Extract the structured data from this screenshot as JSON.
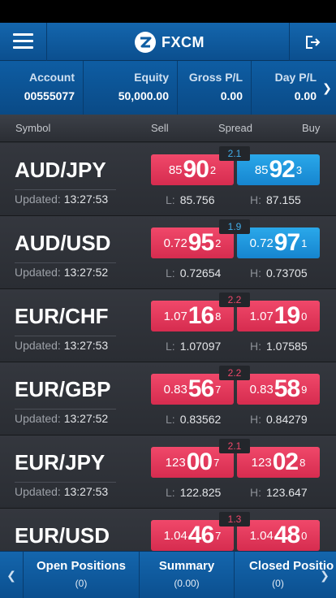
{
  "app": {
    "brand": "FXCM"
  },
  "account_bar": {
    "columns": [
      {
        "label": "Account",
        "value": "00555077"
      },
      {
        "label": "Equity",
        "value": "50,000.00"
      },
      {
        "label": "Gross P/L",
        "value": "0.00"
      },
      {
        "label": "Day P/L",
        "value": "0.00"
      }
    ]
  },
  "table_header": {
    "symbol": "Symbol",
    "sell": "Sell",
    "spread": "Spread",
    "buy": "Buy"
  },
  "rates": [
    {
      "symbol": "AUD/JPY",
      "updated_label": "Updated:",
      "updated": "13:27:53",
      "spread": "2.1",
      "sell": {
        "pre": "85",
        "big": "90",
        "pip": "2"
      },
      "buy": {
        "pre": "85",
        "big": "92",
        "pip": "3"
      },
      "low": "85.756",
      "high": "87.155"
    },
    {
      "symbol": "AUD/USD",
      "updated_label": "Updated:",
      "updated": "13:27:52",
      "spread": "1.9",
      "sell": {
        "pre": "0.72",
        "big": "95",
        "pip": "2"
      },
      "buy": {
        "pre": "0.72",
        "big": "97",
        "pip": "1"
      },
      "low": "0.72654",
      "high": "0.73705"
    },
    {
      "symbol": "EUR/CHF",
      "updated_label": "Updated:",
      "updated": "13:27:53",
      "spread": "2.2",
      "sell": {
        "pre": "1.07",
        "big": "16",
        "pip": "8"
      },
      "buy": {
        "pre": "1.07",
        "big": "19",
        "pip": "0"
      },
      "low": "1.07097",
      "high": "1.07585"
    },
    {
      "symbol": "EUR/GBP",
      "updated_label": "Updated:",
      "updated": "13:27:52",
      "spread": "2.2",
      "sell": {
        "pre": "0.83",
        "big": "56",
        "pip": "7"
      },
      "buy": {
        "pre": "0.83",
        "big": "58",
        "pip": "9"
      },
      "low": "0.83562",
      "high": "0.84279"
    },
    {
      "symbol": "EUR/JPY",
      "updated_label": "Updated:",
      "updated": "13:27:53",
      "spread": "2.1",
      "sell": {
        "pre": "123",
        "big": "00",
        "pip": "7"
      },
      "buy": {
        "pre": "123",
        "big": "02",
        "pip": "8"
      },
      "low": "122.825",
      "high": "123.647"
    },
    {
      "symbol": "EUR/USD",
      "updated_label": "",
      "updated": "",
      "spread": "1.3",
      "sell": {
        "pre": "1.04",
        "big": "46",
        "pip": "7"
      },
      "buy": {
        "pre": "1.04",
        "big": "48",
        "pip": "0"
      },
      "low": "",
      "high": ""
    }
  ],
  "range_labels": {
    "low": "L:",
    "high": "H:"
  },
  "bottom_tabs": [
    {
      "title": "Open Positions",
      "count": "(0)"
    },
    {
      "title": "Summary",
      "count": "(0.00)"
    },
    {
      "title": "Closed Positio",
      "count": "(0)"
    }
  ],
  "colors": {
    "sell": "#e43a5c",
    "buy_up": "#1f97dd",
    "header_blue": "#0e5da3",
    "background": "#2a2d33"
  }
}
